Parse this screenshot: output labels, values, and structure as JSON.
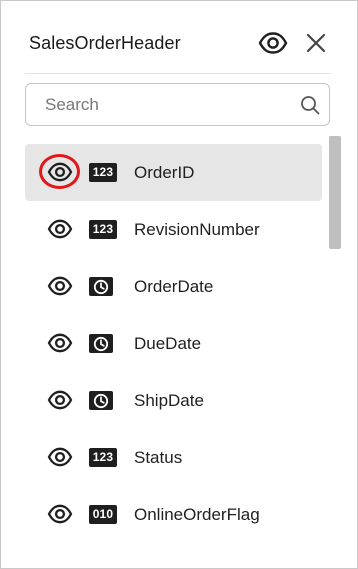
{
  "panel": {
    "title": "SalesOrderHeader"
  },
  "search": {
    "placeholder": "Search",
    "value": ""
  },
  "fields": [
    {
      "name": "OrderID",
      "type_badge": "123",
      "type_icon": "number-icon",
      "visible": true,
      "selected": true
    },
    {
      "name": "RevisionNumber",
      "type_badge": "123",
      "type_icon": "number-icon",
      "visible": true,
      "selected": false
    },
    {
      "name": "OrderDate",
      "type_badge": "",
      "type_icon": "clock-icon",
      "visible": true,
      "selected": false
    },
    {
      "name": "DueDate",
      "type_badge": "",
      "type_icon": "clock-icon",
      "visible": true,
      "selected": false
    },
    {
      "name": "ShipDate",
      "type_badge": "",
      "type_icon": "clock-icon",
      "visible": true,
      "selected": false
    },
    {
      "name": "Status",
      "type_badge": "123",
      "type_icon": "number-icon",
      "visible": true,
      "selected": false
    },
    {
      "name": "OnlineOrderFlag",
      "type_badge": "010",
      "type_icon": "boolean-icon",
      "visible": true,
      "selected": false
    }
  ],
  "colors": {
    "selected_row": "#e6e6e6",
    "highlight_ring": "#e01818",
    "badge": "#1f1f1f"
  }
}
